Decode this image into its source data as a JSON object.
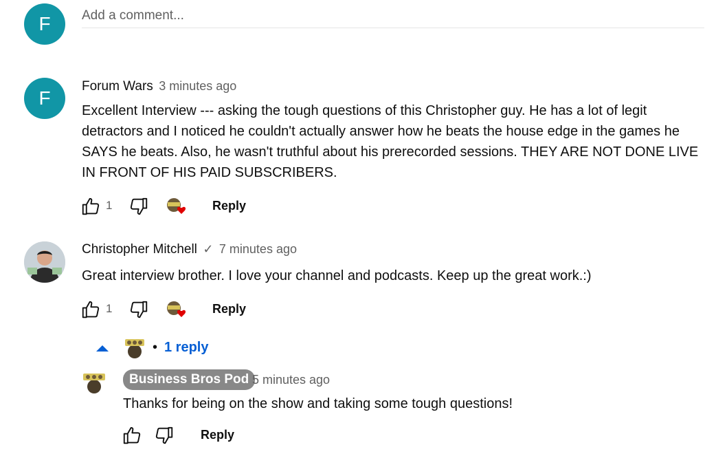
{
  "add_comment": {
    "avatar_letter": "F",
    "placeholder": "Add a comment..."
  },
  "comments": [
    {
      "avatar_letter": "F",
      "author": "Forum Wars",
      "time": "3 minutes ago",
      "text": "Excellent Interview --- asking the tough questions of this Christopher guy. He has a lot of legit detractors and I noticed he couldn't actually answer how he beats the house edge in the games he SAYS he beats. Also, he wasn't truthful about his prerecorded sessions. THEY ARE NOT DONE LIVE IN FRONT OF HIS PAID SUBSCRIBERS.",
      "likes": "1",
      "reply_label": "Reply"
    },
    {
      "author": "Christopher Mitchell",
      "verified_mark": "✓",
      "time": "7 minutes ago",
      "text": "Great interview brother. I love your channel and podcasts. Keep up the great work.:)",
      "likes": "1",
      "reply_label": "Reply",
      "replies_toggle": "1 reply",
      "replies_separator": "•"
    }
  ],
  "reply": {
    "author": "Business Bros Pod",
    "time": "5 minutes ago",
    "text": "Thanks for being on the show and taking some tough questions!",
    "reply_label": "Reply"
  },
  "icons": {
    "like": "thumbs-up-icon",
    "dislike": "thumbs-down-icon",
    "heart": "creator-heart-icon",
    "toggle": "caret-up-icon"
  },
  "colors": {
    "avatar": "#1196a6",
    "link": "#065fd4",
    "heart": "#e00000",
    "badge": "#888888"
  }
}
